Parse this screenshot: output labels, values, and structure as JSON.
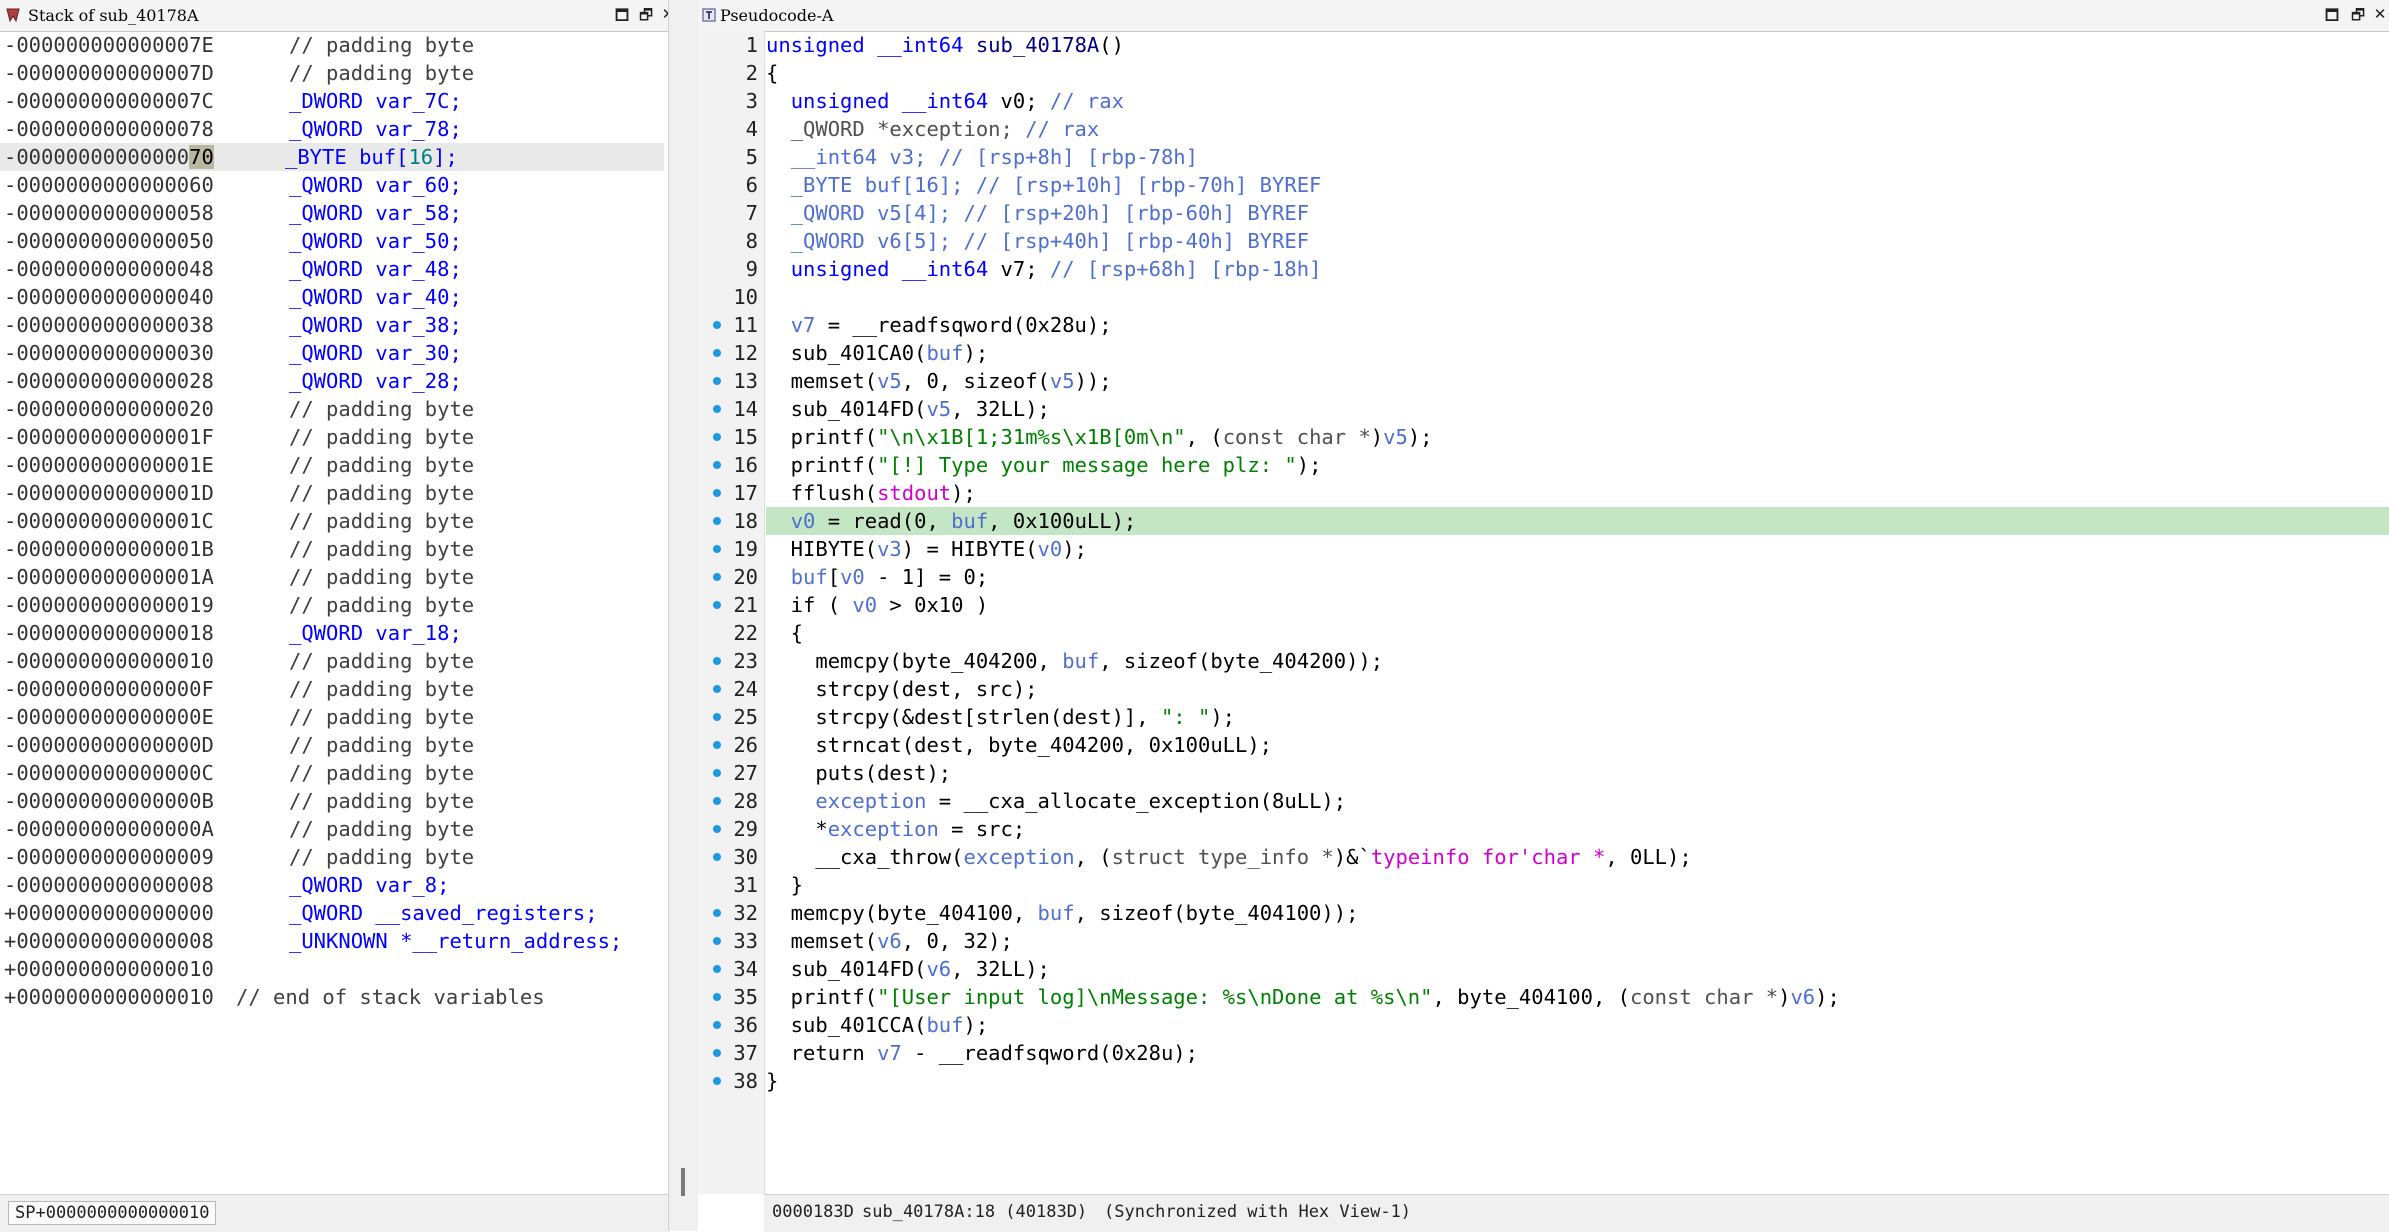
{
  "stack_pane": {
    "title": "Stack of sub_40178A",
    "status": "SP+0000000000000010",
    "rows": [
      {
        "off": "-000000000000007E",
        "decl": "// padding byte",
        "kind": "pad"
      },
      {
        "off": "-000000000000007D",
        "decl": "// padding byte",
        "kind": "pad"
      },
      {
        "off": "-000000000000007C",
        "type": "_DWORD",
        "name": "var_7C;",
        "kind": "var"
      },
      {
        "off": "-0000000000000078",
        "type": "_QWORD",
        "name": "var_78;",
        "kind": "var"
      },
      {
        "off": "-00000000000000",
        "off_hl": "70",
        "type": "_BYTE",
        "name": "buf[",
        "size": "16",
        "close": "];",
        "kind": "arr",
        "sel": true
      },
      {
        "off": "-0000000000000060",
        "type": "_QWORD",
        "name": "var_60;",
        "kind": "var"
      },
      {
        "off": "-0000000000000058",
        "type": "_QWORD",
        "name": "var_58;",
        "kind": "var"
      },
      {
        "off": "-0000000000000050",
        "type": "_QWORD",
        "name": "var_50;",
        "kind": "var"
      },
      {
        "off": "-0000000000000048",
        "type": "_QWORD",
        "name": "var_48;",
        "kind": "var"
      },
      {
        "off": "-0000000000000040",
        "type": "_QWORD",
        "name": "var_40;",
        "kind": "var"
      },
      {
        "off": "-0000000000000038",
        "type": "_QWORD",
        "name": "var_38;",
        "kind": "var"
      },
      {
        "off": "-0000000000000030",
        "type": "_QWORD",
        "name": "var_30;",
        "kind": "var"
      },
      {
        "off": "-0000000000000028",
        "type": "_QWORD",
        "name": "var_28;",
        "kind": "var"
      },
      {
        "off": "-0000000000000020",
        "decl": "// padding byte",
        "kind": "pad"
      },
      {
        "off": "-000000000000001F",
        "decl": "// padding byte",
        "kind": "pad"
      },
      {
        "off": "-000000000000001E",
        "decl": "// padding byte",
        "kind": "pad"
      },
      {
        "off": "-000000000000001D",
        "decl": "// padding byte",
        "kind": "pad"
      },
      {
        "off": "-000000000000001C",
        "decl": "// padding byte",
        "kind": "pad"
      },
      {
        "off": "-000000000000001B",
        "decl": "// padding byte",
        "kind": "pad"
      },
      {
        "off": "-000000000000001A",
        "decl": "// padding byte",
        "kind": "pad"
      },
      {
        "off": "-0000000000000019",
        "decl": "// padding byte",
        "kind": "pad"
      },
      {
        "off": "-0000000000000018",
        "type": "_QWORD",
        "name": "var_18;",
        "kind": "var"
      },
      {
        "off": "-0000000000000010",
        "decl": "// padding byte",
        "kind": "pad"
      },
      {
        "off": "-000000000000000F",
        "decl": "// padding byte",
        "kind": "pad"
      },
      {
        "off": "-000000000000000E",
        "decl": "// padding byte",
        "kind": "pad"
      },
      {
        "off": "-000000000000000D",
        "decl": "// padding byte",
        "kind": "pad"
      },
      {
        "off": "-000000000000000C",
        "decl": "// padding byte",
        "kind": "pad"
      },
      {
        "off": "-000000000000000B",
        "decl": "// padding byte",
        "kind": "pad"
      },
      {
        "off": "-000000000000000A",
        "decl": "// padding byte",
        "kind": "pad"
      },
      {
        "off": "-0000000000000009",
        "decl": "// padding byte",
        "kind": "pad"
      },
      {
        "off": "-0000000000000008",
        "type": "_QWORD",
        "name": "var_8;",
        "kind": "var"
      },
      {
        "off": "+0000000000000000",
        "type": "_QWORD",
        "name": "__saved_registers;",
        "kind": "var"
      },
      {
        "off": "+0000000000000008",
        "type": "_UNKNOWN",
        "name": "*__return_address;",
        "kind": "var"
      },
      {
        "off": "+0000000000000010",
        "kind": "blank"
      },
      {
        "off": "+0000000000000010",
        "decl": "// end of stack variables",
        "kind": "end"
      }
    ]
  },
  "code_pane": {
    "title": "Pseudocode-A",
    "status_addr": "0000183D",
    "status_loc": "sub_40178A:18 (40183D)",
    "status_sync": "(Synchronized with Hex View-1)",
    "current_line": 18,
    "lines": [
      {
        "n": 1,
        "dot": false,
        "t": [
          [
            "kw",
            "unsigned __int64 "
          ],
          [
            "fn",
            "sub_40178A"
          ],
          [
            "",
            "()"
          ]
        ]
      },
      {
        "n": 2,
        "dot": false,
        "t": [
          [
            "",
            "{"
          ]
        ]
      },
      {
        "n": 3,
        "dot": false,
        "t": [
          [
            "",
            "  "
          ],
          [
            "kw",
            "unsigned __int64 "
          ],
          [
            "",
            "v0; "
          ],
          [
            "var",
            "// rax"
          ]
        ]
      },
      {
        "n": 4,
        "dot": false,
        "t": [
          [
            "",
            "  "
          ],
          [
            "gray",
            "_QWORD *exception; "
          ],
          [
            "var",
            "// rax"
          ]
        ]
      },
      {
        "n": 5,
        "dot": false,
        "t": [
          [
            "",
            "  "
          ],
          [
            "var",
            "__int64 v3; // [rsp+8h] [rbp-78h]"
          ]
        ]
      },
      {
        "n": 6,
        "dot": false,
        "t": [
          [
            "",
            "  "
          ],
          [
            "var",
            "_BYTE buf[16]; // [rsp+10h] [rbp-70h] BYREF"
          ]
        ]
      },
      {
        "n": 7,
        "dot": false,
        "t": [
          [
            "",
            "  "
          ],
          [
            "var",
            "_QWORD v5[4]; // [rsp+20h] [rbp-60h] BYREF"
          ]
        ]
      },
      {
        "n": 8,
        "dot": false,
        "t": [
          [
            "",
            "  "
          ],
          [
            "var",
            "_QWORD v6[5]; // [rsp+40h] [rbp-40h] BYREF"
          ]
        ]
      },
      {
        "n": 9,
        "dot": false,
        "t": [
          [
            "",
            "  "
          ],
          [
            "kw",
            "unsigned __int64 "
          ],
          [
            "",
            "v7; "
          ],
          [
            "var",
            "// [rsp+68h] [rbp-18h]"
          ]
        ]
      },
      {
        "n": 10,
        "dot": false,
        "t": [
          [
            "",
            ""
          ]
        ]
      },
      {
        "n": 11,
        "dot": true,
        "t": [
          [
            "",
            "  "
          ],
          [
            "var",
            "v7"
          ],
          [
            "",
            " = __readfsqword(0x28u);"
          ]
        ]
      },
      {
        "n": 12,
        "dot": true,
        "t": [
          [
            "",
            "  sub_401CA0("
          ],
          [
            "var",
            "buf"
          ],
          [
            "",
            ");"
          ]
        ]
      },
      {
        "n": 13,
        "dot": true,
        "t": [
          [
            "",
            "  memset("
          ],
          [
            "var",
            "v5"
          ],
          [
            "",
            ", 0, sizeof("
          ],
          [
            "var",
            "v5"
          ],
          [
            "",
            "));"
          ]
        ]
      },
      {
        "n": 14,
        "dot": true,
        "t": [
          [
            "",
            "  sub_4014FD("
          ],
          [
            "var",
            "v5"
          ],
          [
            "",
            ", 32LL);"
          ]
        ]
      },
      {
        "n": 15,
        "dot": true,
        "t": [
          [
            "",
            "  printf("
          ],
          [
            "str",
            "\"\\n\\x1B[1;31m%s\\x1B[0m\\n\""
          ],
          [
            "",
            ", ("
          ],
          [
            "gray",
            "const char *"
          ],
          [
            "",
            ")"
          ],
          [
            "var",
            "v5"
          ],
          [
            "",
            ");"
          ]
        ]
      },
      {
        "n": 16,
        "dot": true,
        "t": [
          [
            "",
            "  printf("
          ],
          [
            "str",
            "\"[!] Type your message here plz: \""
          ],
          [
            "",
            ");"
          ]
        ]
      },
      {
        "n": 17,
        "dot": true,
        "t": [
          [
            "",
            "  fflush("
          ],
          [
            "mag",
            "stdout"
          ],
          [
            "",
            ");"
          ]
        ]
      },
      {
        "n": 18,
        "dot": true,
        "t": [
          [
            "",
            "  "
          ],
          [
            "var",
            "v0"
          ],
          [
            "",
            " = read(0, "
          ],
          [
            "var",
            "buf"
          ],
          [
            "",
            ", 0x100uLL);"
          ]
        ]
      },
      {
        "n": 19,
        "dot": true,
        "t": [
          [
            "",
            "  HIBYTE("
          ],
          [
            "var",
            "v3"
          ],
          [
            "",
            ") = HIBYTE("
          ],
          [
            "var",
            "v0"
          ],
          [
            "",
            ");"
          ]
        ]
      },
      {
        "n": 20,
        "dot": true,
        "t": [
          [
            "",
            "  "
          ],
          [
            "var",
            "buf"
          ],
          [
            "",
            "["
          ],
          [
            "var",
            "v0"
          ],
          [
            "",
            " - 1] = 0;"
          ]
        ]
      },
      {
        "n": 21,
        "dot": true,
        "t": [
          [
            "",
            "  if ( "
          ],
          [
            "var",
            "v0"
          ],
          [
            "",
            " > 0x10 )"
          ]
        ]
      },
      {
        "n": 22,
        "dot": false,
        "t": [
          [
            "",
            "  {"
          ]
        ]
      },
      {
        "n": 23,
        "dot": true,
        "t": [
          [
            "",
            "    memcpy(byte_404200, "
          ],
          [
            "var",
            "buf"
          ],
          [
            "",
            ", sizeof(byte_404200));"
          ]
        ]
      },
      {
        "n": 24,
        "dot": true,
        "t": [
          [
            "",
            "    strcpy(dest, src);"
          ]
        ]
      },
      {
        "n": 25,
        "dot": true,
        "t": [
          [
            "",
            "    strcpy(&dest[strlen(dest)], "
          ],
          [
            "str",
            "\": \""
          ],
          [
            "",
            ");"
          ]
        ]
      },
      {
        "n": 26,
        "dot": true,
        "t": [
          [
            "",
            "    strncat(dest, byte_404200, 0x100uLL);"
          ]
        ]
      },
      {
        "n": 27,
        "dot": true,
        "t": [
          [
            "",
            "    puts(dest);"
          ]
        ]
      },
      {
        "n": 28,
        "dot": true,
        "t": [
          [
            "",
            "    "
          ],
          [
            "var",
            "exception"
          ],
          [
            "",
            " = __cxa_allocate_exception(8uLL);"
          ]
        ]
      },
      {
        "n": 29,
        "dot": true,
        "t": [
          [
            "",
            "    *"
          ],
          [
            "var",
            "exception"
          ],
          [
            "",
            " = src;"
          ]
        ]
      },
      {
        "n": 30,
        "dot": true,
        "t": [
          [
            "",
            "    __cxa_throw("
          ],
          [
            "var",
            "exception"
          ],
          [
            "",
            ", ("
          ],
          [
            "gray",
            "struct type_info *"
          ],
          [
            "",
            ")&`"
          ],
          [
            "mag",
            "typeinfo for'char *"
          ],
          [
            "",
            ", 0LL);"
          ]
        ]
      },
      {
        "n": 31,
        "dot": false,
        "t": [
          [
            "",
            "  }"
          ]
        ]
      },
      {
        "n": 32,
        "dot": true,
        "t": [
          [
            "",
            "  memcpy(byte_404100, "
          ],
          [
            "var",
            "buf"
          ],
          [
            "",
            ", sizeof(byte_404100));"
          ]
        ]
      },
      {
        "n": 33,
        "dot": true,
        "t": [
          [
            "",
            "  memset("
          ],
          [
            "var",
            "v6"
          ],
          [
            "",
            ", 0, 32);"
          ]
        ]
      },
      {
        "n": 34,
        "dot": true,
        "t": [
          [
            "",
            "  sub_4014FD("
          ],
          [
            "var",
            "v6"
          ],
          [
            "",
            ", 32LL);"
          ]
        ]
      },
      {
        "n": 35,
        "dot": true,
        "t": [
          [
            "",
            "  printf("
          ],
          [
            "str",
            "\"[User input log]\\nMessage: %s\\nDone at %s\\n\""
          ],
          [
            "",
            ", byte_404100, ("
          ],
          [
            "gray",
            "const char *"
          ],
          [
            "",
            ")"
          ],
          [
            "var",
            "v6"
          ],
          [
            "",
            ");"
          ]
        ]
      },
      {
        "n": 36,
        "dot": true,
        "t": [
          [
            "",
            "  sub_401CCA("
          ],
          [
            "var",
            "buf"
          ],
          [
            "",
            ");"
          ]
        ]
      },
      {
        "n": 37,
        "dot": true,
        "t": [
          [
            "",
            "  return "
          ],
          [
            "var",
            "v7"
          ],
          [
            "",
            " - __readfsqword(0x28u);"
          ]
        ]
      },
      {
        "n": 38,
        "dot": true,
        "t": [
          [
            "",
            "}"
          ]
        ]
      }
    ]
  },
  "colors": {
    "keyword": "#0000ff",
    "local_var": "#4f6fd0",
    "string": "#008000",
    "import": "#d000d0",
    "current_line": "#c4e6c4",
    "gutter_dot": "#1a9ae0"
  },
  "icons": [
    "stack-view-icon",
    "pseudocode-icon",
    "maximize-icon",
    "restore-icon",
    "close-icon"
  ]
}
